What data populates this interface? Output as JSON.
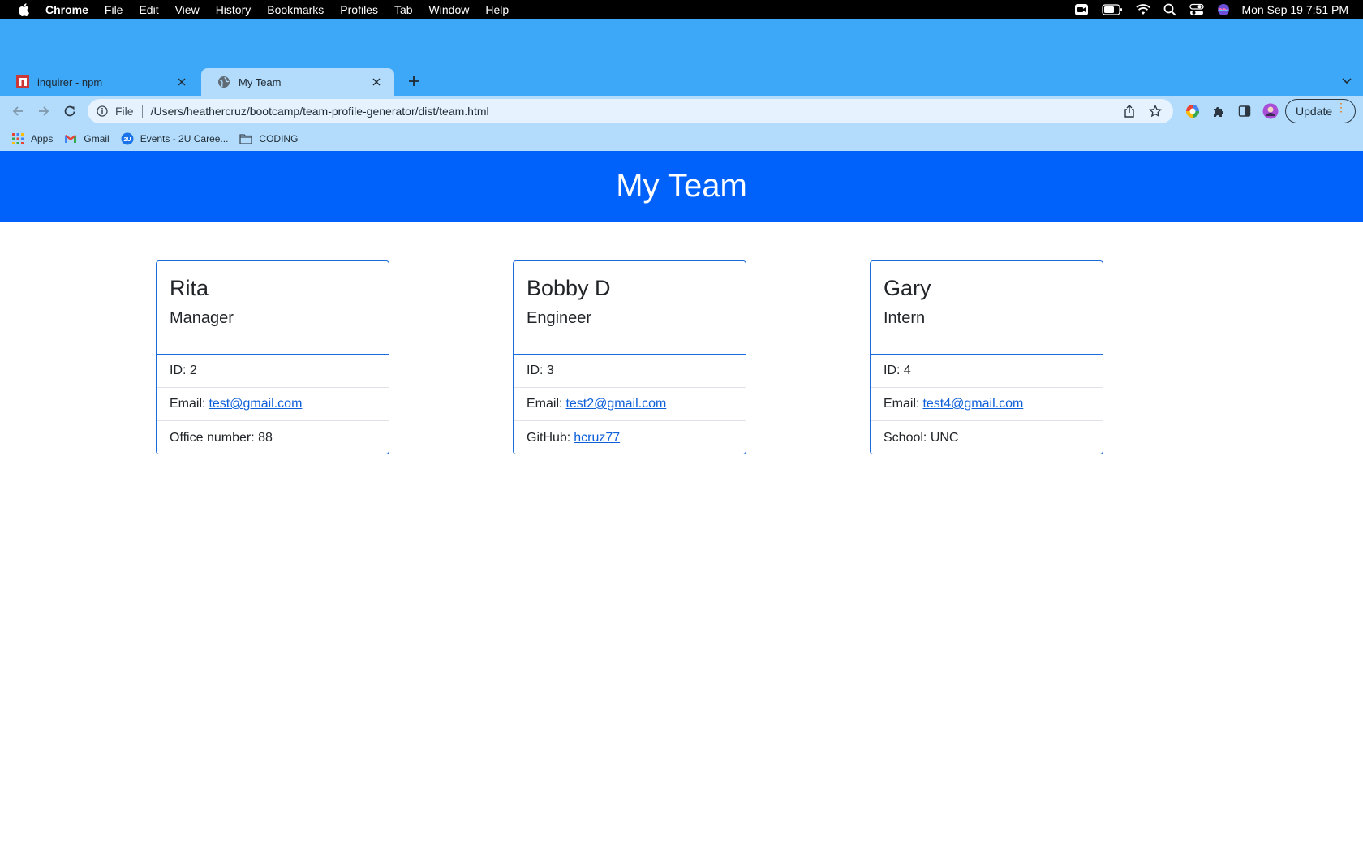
{
  "menubar": {
    "app": "Chrome",
    "items": [
      "File",
      "Edit",
      "View",
      "History",
      "Bookmarks",
      "Profiles",
      "Tab",
      "Window",
      "Help"
    ],
    "clock": "Mon Sep 19  7:51 PM"
  },
  "tabs": [
    {
      "title": "inquirer - npm",
      "icon": "npm-icon",
      "active": false
    },
    {
      "title": "My Team",
      "icon": "globe-icon",
      "active": true
    }
  ],
  "address_bar": {
    "scheme_label": "File",
    "url": "/Users/heathercruz/bootcamp/team-profile-generator/dist/team.html"
  },
  "update_button": {
    "label": "Update"
  },
  "bookmarks": [
    {
      "label": "Apps",
      "icon": "apps-grid-icon"
    },
    {
      "label": "Gmail",
      "icon": "gmail-icon"
    },
    {
      "label": "Events - 2U Caree...",
      "icon": "2u-icon"
    },
    {
      "label": "CODING",
      "icon": "folder-icon"
    }
  ],
  "page": {
    "title": "My Team",
    "cards": [
      {
        "name": "Rita",
        "role": "Manager",
        "id_text": "ID: 2",
        "email_label": "Email:",
        "email": "test@gmail.com",
        "extra_label": "Office number: 88",
        "extra_link": ""
      },
      {
        "name": "Bobby D",
        "role": "Engineer",
        "id_text": "ID: 3",
        "email_label": "Email:",
        "email": "test2@gmail.com",
        "extra_label": "GitHub:",
        "extra_link": "hcruz77"
      },
      {
        "name": "Gary",
        "role": "Intern",
        "id_text": "ID: 4",
        "email_label": "Email:",
        "email": "test4@gmail.com",
        "extra_label": "School: UNC",
        "extra_link": ""
      }
    ]
  },
  "colors": {
    "tabstrip": "#3ea8f8",
    "toolbar": "#b3dcfc",
    "jumbotron": "#0062fa",
    "card_border": "#1a6cdc",
    "link": "#0d5fd8"
  }
}
